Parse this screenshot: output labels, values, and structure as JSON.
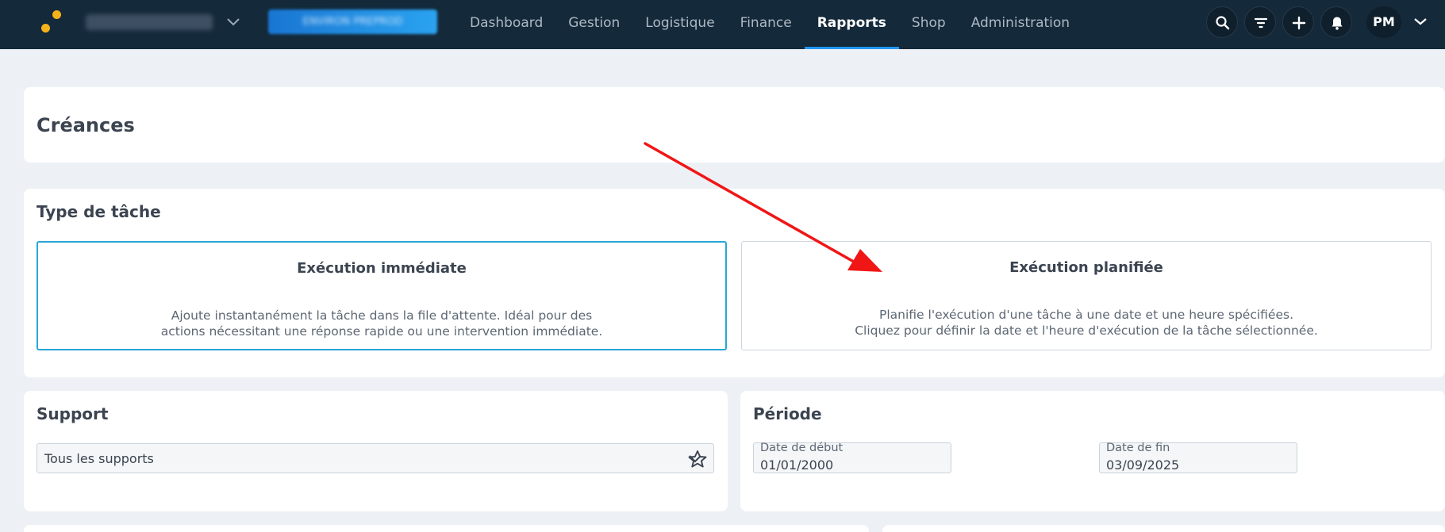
{
  "header": {
    "company_name": "NORMETOR SAS",
    "environment_badge": "ENVIRON PREPROD",
    "nav_items": [
      {
        "label": "Dashboard",
        "active": false
      },
      {
        "label": "Gestion",
        "active": false
      },
      {
        "label": "Logistique",
        "active": false
      },
      {
        "label": "Finance",
        "active": false
      },
      {
        "label": "Rapports",
        "active": true
      },
      {
        "label": "Shop",
        "active": false
      },
      {
        "label": "Administration",
        "active": false
      }
    ],
    "icons": [
      "search-icon",
      "filter-icon",
      "plus-icon",
      "bell-icon"
    ],
    "user_initials": "PM",
    "accent_color": "#2196f3"
  },
  "page": {
    "title": "Créances"
  },
  "task_type": {
    "title": "Type de tâche",
    "options": [
      {
        "title": "Exécution immédiate",
        "description_line1": "Ajoute instantanément la tâche dans la file d'attente. Idéal pour des",
        "description_line2": "actions nécessitant une réponse rapide ou une intervention immédiate.",
        "selected": true
      },
      {
        "title": "Exécution planifiée",
        "description_line1": "Planifie l'exécution d'une tâche à une date et une heure spécifiées.",
        "description_line2": "Cliquez pour définir la date et l'heure d'exécution de la tâche sélectionnée.",
        "selected": false
      }
    ]
  },
  "support": {
    "title": "Support",
    "selected_value": "Tous les supports"
  },
  "period": {
    "title": "Période",
    "start_label": "Date de début",
    "start_value": "01/01/2000",
    "end_label": "Date de fin",
    "end_value": "03/09/2025"
  },
  "annotation": {
    "arrow_color": "#f01616"
  }
}
